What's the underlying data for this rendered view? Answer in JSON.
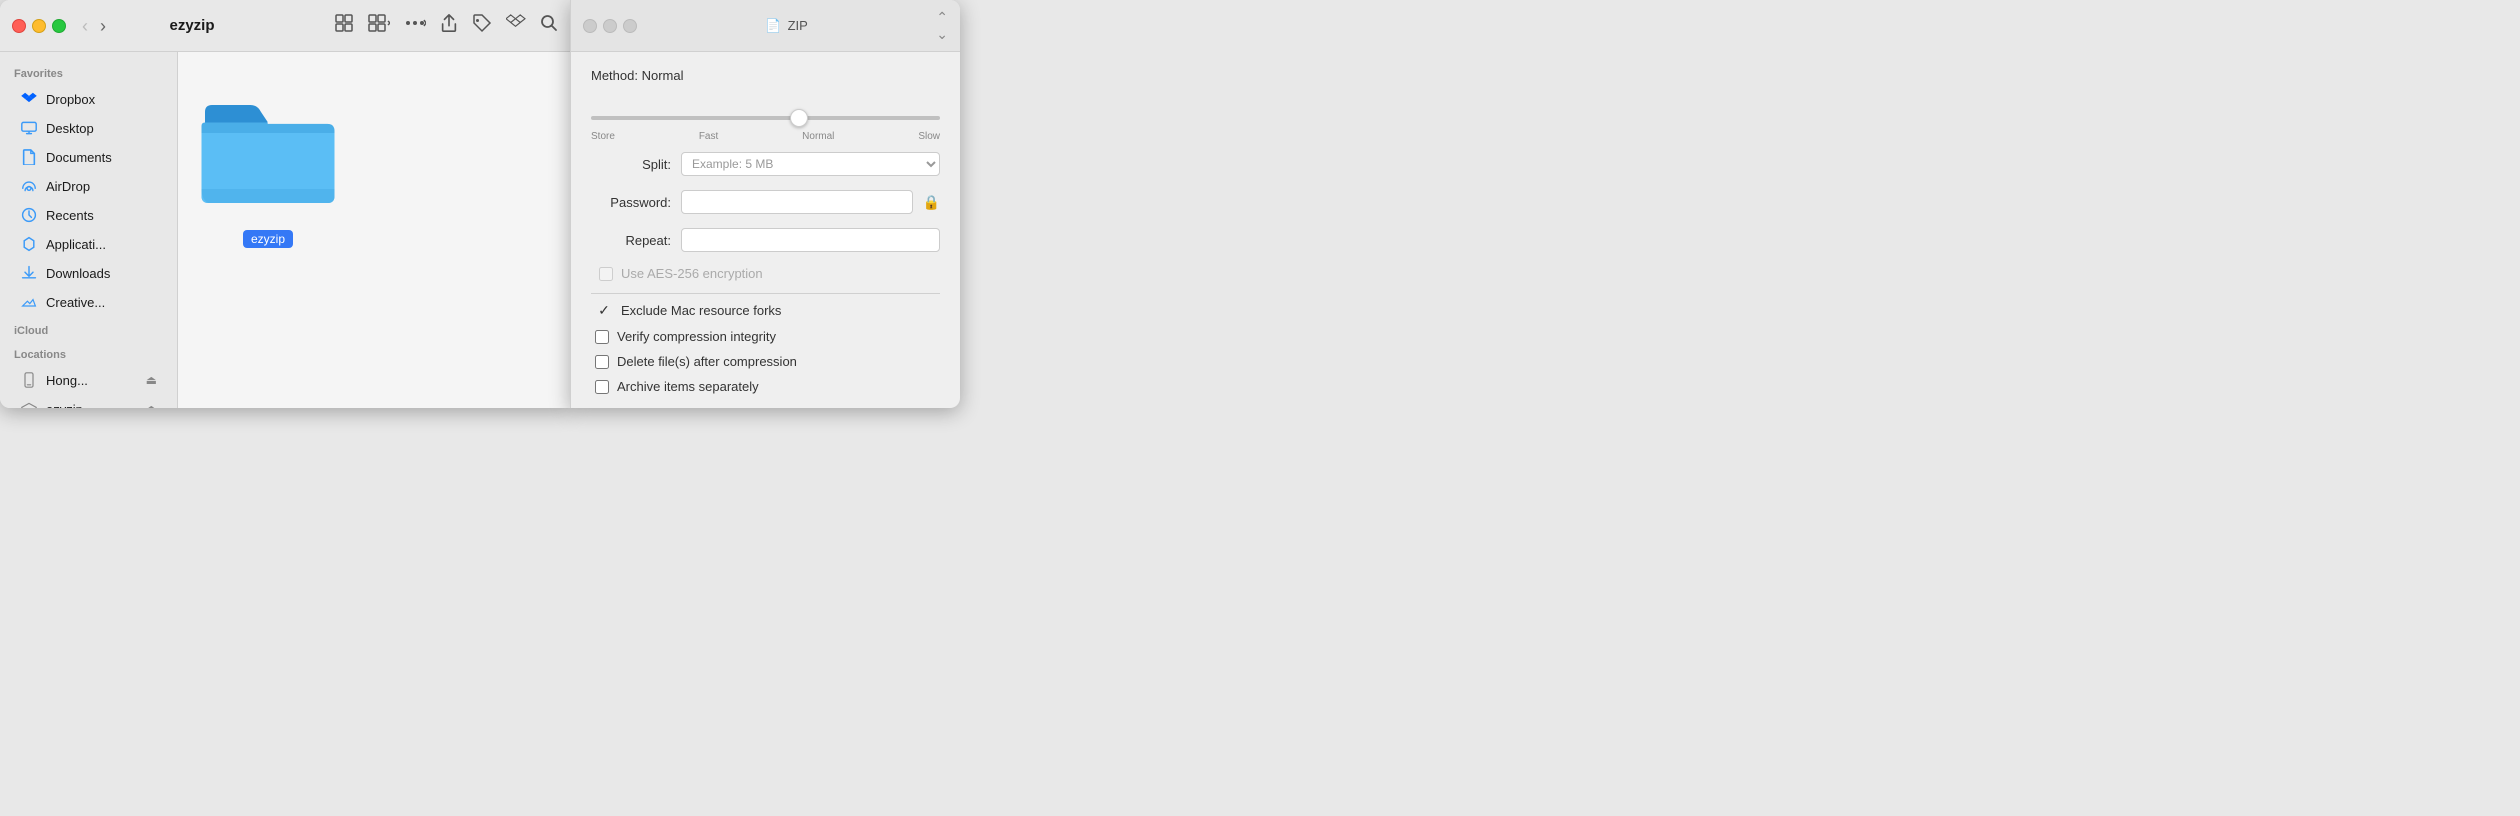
{
  "finder": {
    "title": "ezyzip",
    "sidebar": {
      "section_favorites": "Favorites",
      "section_icloud": "iCloud",
      "section_locations": "Locations",
      "items_favorites": [
        {
          "id": "dropbox",
          "label": "Dropbox",
          "icon": "dropbox-icon"
        },
        {
          "id": "desktop",
          "label": "Desktop",
          "icon": "desktop-icon"
        },
        {
          "id": "documents",
          "label": "Documents",
          "icon": "documents-icon"
        },
        {
          "id": "airdrop",
          "label": "AirDrop",
          "icon": "airdrop-icon"
        },
        {
          "id": "recents",
          "label": "Recents",
          "icon": "recents-icon"
        },
        {
          "id": "applications",
          "label": "Applicati...",
          "icon": "applications-icon"
        },
        {
          "id": "downloads",
          "label": "Downloads",
          "icon": "downloads-icon"
        },
        {
          "id": "creative",
          "label": "Creative...",
          "icon": "creative-icon"
        }
      ],
      "items_locations": [
        {
          "id": "hong",
          "label": "Hong...",
          "icon": "phone-icon"
        },
        {
          "id": "ezyzip",
          "label": "ezyzip",
          "icon": "drive-icon"
        }
      ]
    },
    "folder": {
      "name": "ezyzip"
    }
  },
  "zip_panel": {
    "title": "ZIP",
    "method_label": "Method: Normal",
    "slider": {
      "value": 60,
      "labels": [
        "Store",
        "Fast",
        "Normal",
        "Slow"
      ]
    },
    "split_label": "Split:",
    "split_placeholder": "Example: 5 MB",
    "password_label": "Password:",
    "repeat_label": "Repeat:",
    "aes_label": "Use AES-256 encryption",
    "checkboxes": [
      {
        "id": "exclude_mac",
        "label": "Exclude Mac resource forks",
        "checked": true
      },
      {
        "id": "verify",
        "label": "Verify compression integrity",
        "checked": false
      },
      {
        "id": "delete_files",
        "label": "Delete file(s) after compression",
        "checked": false
      },
      {
        "id": "archive_separately",
        "label": "Archive items separately",
        "checked": false
      }
    ]
  },
  "toolbar": {
    "back_label": "‹",
    "forward_label": "›",
    "view_grid": "⊞",
    "view_options": "⊞",
    "more_options": "•••",
    "share": "↑",
    "tag": "🏷",
    "dropbox": "❖",
    "search": "⌕"
  }
}
